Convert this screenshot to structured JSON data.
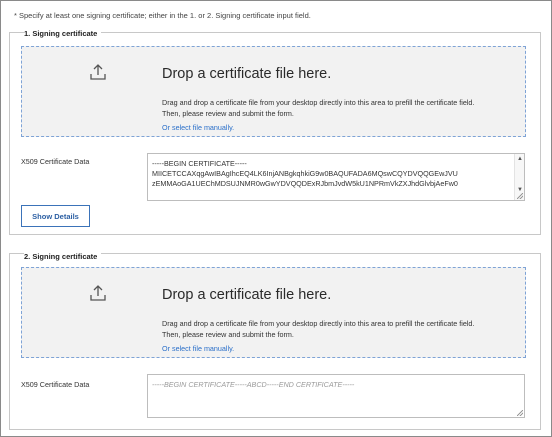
{
  "note": "* Specify at least one signing certificate; either in the 1. or 2. Signing certificate input field.",
  "sections": [
    {
      "title": "1. Signing certificate",
      "dropzone": {
        "icon": "upload-icon",
        "title": "Drop a certificate file here.",
        "desc_line1": "Drag and drop a certificate file from your desktop directly into this area to prefill the certificate field.",
        "desc_line2": "Then, please review and submit the form.",
        "manual_link": "Or select file manually."
      },
      "field_label": "X509 Certificate Data",
      "cert_lines": [
        "-----BEGIN CERTIFICATE-----",
        "MIICETCCAXqgAwIBAgIhcEQ4LK6InjANBgkqhkiG9w0BAQUFADA6MQswCQYDVQQGEwJVU",
        "zEMMAoGA1UEChMDSUJNMR0wGwYDVQQDExRJbmJvdW5kU1NPRmVkZXJhdGlvbjAeFw0"
      ],
      "show_details": "Show Details"
    },
    {
      "title": "2. Signing certificate",
      "dropzone": {
        "icon": "upload-icon",
        "title": "Drop a certificate file here.",
        "desc_line1": "Drag and drop a certificate file from your desktop directly into this area to prefill the certificate field.",
        "desc_line2": "Then, please review and submit the form.",
        "manual_link": "Or select file manually."
      },
      "field_label": "X509 Certificate Data",
      "cert_placeholder": "-----BEGIN CERTIFICATE-----ABCD-----END CERTIFICATE-----"
    }
  ],
  "colors": {
    "accent": "#3b73b9",
    "link": "#2a6fc9",
    "dropzone_bg": "#f2f2f2",
    "dropzone_border": "#7ea3d6"
  }
}
